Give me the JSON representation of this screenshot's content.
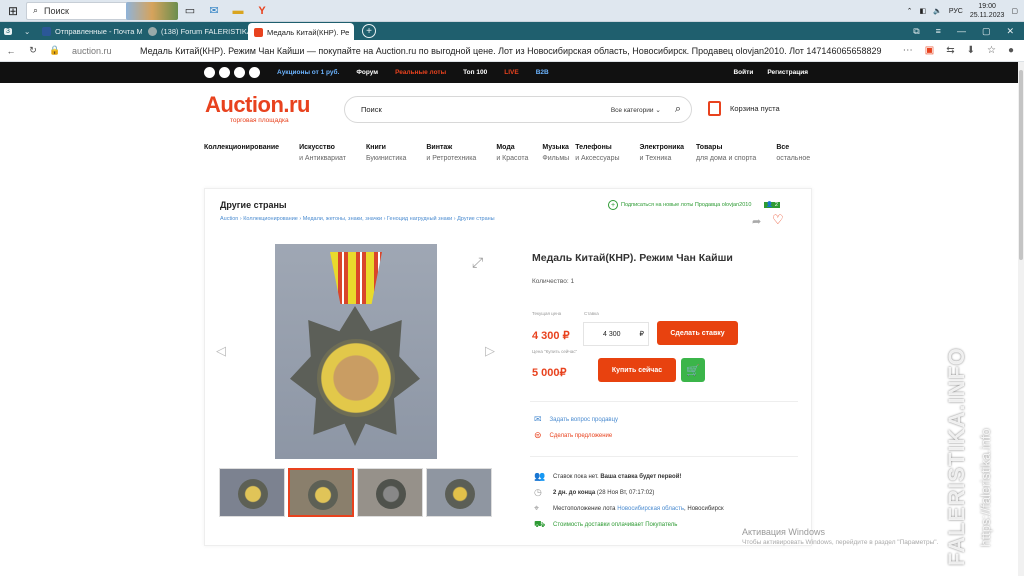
{
  "taskbar": {
    "search_placeholder": "Поиск",
    "lang": "РУС",
    "time": "19:00",
    "date": "25.11.2023"
  },
  "tabs": [
    {
      "label": "Отправленные - Почта M",
      "color": "#2b5797"
    },
    {
      "label": "(138) Forum FALERISTIKA.i",
      "color": "#7a7a7a"
    },
    {
      "label": "Медаль Китай(КНР). Ре",
      "color": "#e8421e"
    }
  ],
  "address": {
    "url": "auction.ru",
    "page_title": "Медаль Китай(КНР). Режим Чан Кайши — покупайте на Auction.ru по выгодной цене. Лот из Новосибирская область, Новосибирск. Продавец olovjan2010. Лот 147146065658829"
  },
  "site_bar": {
    "links": [
      "Аукционы от 1 руб.",
      "Форум",
      "Реальные лоты",
      "Топ 100",
      "LIVE",
      "B2B"
    ],
    "login": "Войти",
    "register": "Регистрация"
  },
  "header": {
    "logo": "Auction.ru",
    "logo_sub": "торговая площадка",
    "search_placeholder": "Поиск",
    "all_categories": "Все категории",
    "cart": "Корзина пуста"
  },
  "categories": [
    {
      "title": "Коллекционирование",
      "sub": ""
    },
    {
      "title": "Искусство",
      "sub": "и Антиквариат"
    },
    {
      "title": "Книги",
      "sub": "Букинистика"
    },
    {
      "title": "Винтаж",
      "sub": "и Ретротехника"
    },
    {
      "title": "Мода",
      "sub": "и Красота"
    },
    {
      "title": "Музыка",
      "sub": "Фильмы"
    },
    {
      "title": "Телефоны",
      "sub": "и Аксессуары"
    },
    {
      "title": "Электроника",
      "sub": "и Техника"
    },
    {
      "title": "Товары",
      "sub": "для дома и спорта"
    },
    {
      "title": "Все",
      "sub": "остальное"
    }
  ],
  "lot": {
    "category": "Другие страны",
    "breadcrumbs": "Auction  ›  Коллекционирование  ›  Медали, жетоны, знаки, значки  ›  Геноцид нагрудный знаки  ›  Другие страны",
    "subscribe": "Подписаться на новые лоты Продавца olovjan2010",
    "subscribe_count": "2",
    "title": "Медаль Китай(КНР). Режим Чан Кайши",
    "quantity": "Количество: 1",
    "current_label": "Текущая цена",
    "bid_label": "Ставка",
    "current_price": "4 300 ₽",
    "bid_value": "4 300",
    "bid_currency": "₽",
    "bid_button": "Сделать ставку",
    "buy_now_label": "Цена \"Купить сейчас\"",
    "buy_now_price": "5 000₽",
    "buy_button": "Купить сейчас",
    "ask_seller": "Задать вопрос продавцу",
    "make_offer": "Сделать предложение",
    "no_bids": "Ставок пока нет.",
    "first_bid": "Ваша ставка будет первой!",
    "time_left": "2 дн. до конца",
    "end_date": "(28 Ноя Вт, 07:17:02)",
    "location_label": "Местоположение лота",
    "location_region": "Новосибирская область",
    "location_city": ", Новосибирск",
    "shipping": "Стоимость доставки оплачивает",
    "shipping_payer": "Покупатель"
  },
  "watermark": {
    "windows_title": "Активация Windows",
    "windows_sub": "Чтобы активировать Windows, перейдите в раздел \"Параметры\".",
    "site_big": "FALERISTIKA.INFO",
    "site_small": "https://faleristika.info"
  }
}
